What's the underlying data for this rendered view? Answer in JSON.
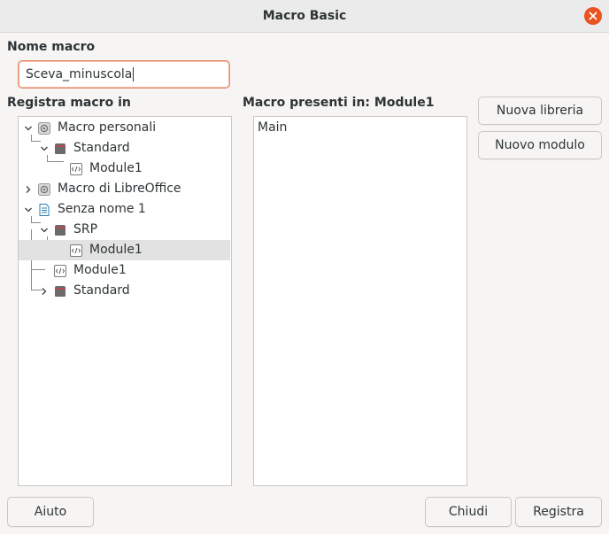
{
  "window": {
    "title": "Macro Basic",
    "close_icon": "close-icon",
    "accent_color": "#e95420"
  },
  "macro_name": {
    "label": "Nome macro",
    "value": "Sceva_minuscola"
  },
  "save_in": {
    "label": "Registra macro in",
    "tree": [
      {
        "label": "Macro personali",
        "icon": "macro-container-icon",
        "expanded": true
      },
      {
        "label": "Standard",
        "icon": "library-icon",
        "expanded": true
      },
      {
        "label": "Module1",
        "icon": "module-icon"
      },
      {
        "label": "Macro di LibreOffice",
        "icon": "macro-container-icon",
        "expanded": false
      },
      {
        "label": "Senza nome 1",
        "icon": "document-icon",
        "expanded": true
      },
      {
        "label": "SRP",
        "icon": "library-icon",
        "expanded": true
      },
      {
        "label": "Module1",
        "icon": "module-icon",
        "selected": true
      },
      {
        "label": "Module1",
        "icon": "module-icon"
      },
      {
        "label": "Standard",
        "icon": "library-icon",
        "expanded": false
      }
    ]
  },
  "existing": {
    "label": "Macro presenti in: Module1",
    "items": [
      "Main"
    ]
  },
  "buttons": {
    "new_library": "Nuova libreria",
    "new_module": "Nuovo modulo",
    "help": "Aiuto",
    "close": "Chiudi",
    "save": "Registra"
  }
}
